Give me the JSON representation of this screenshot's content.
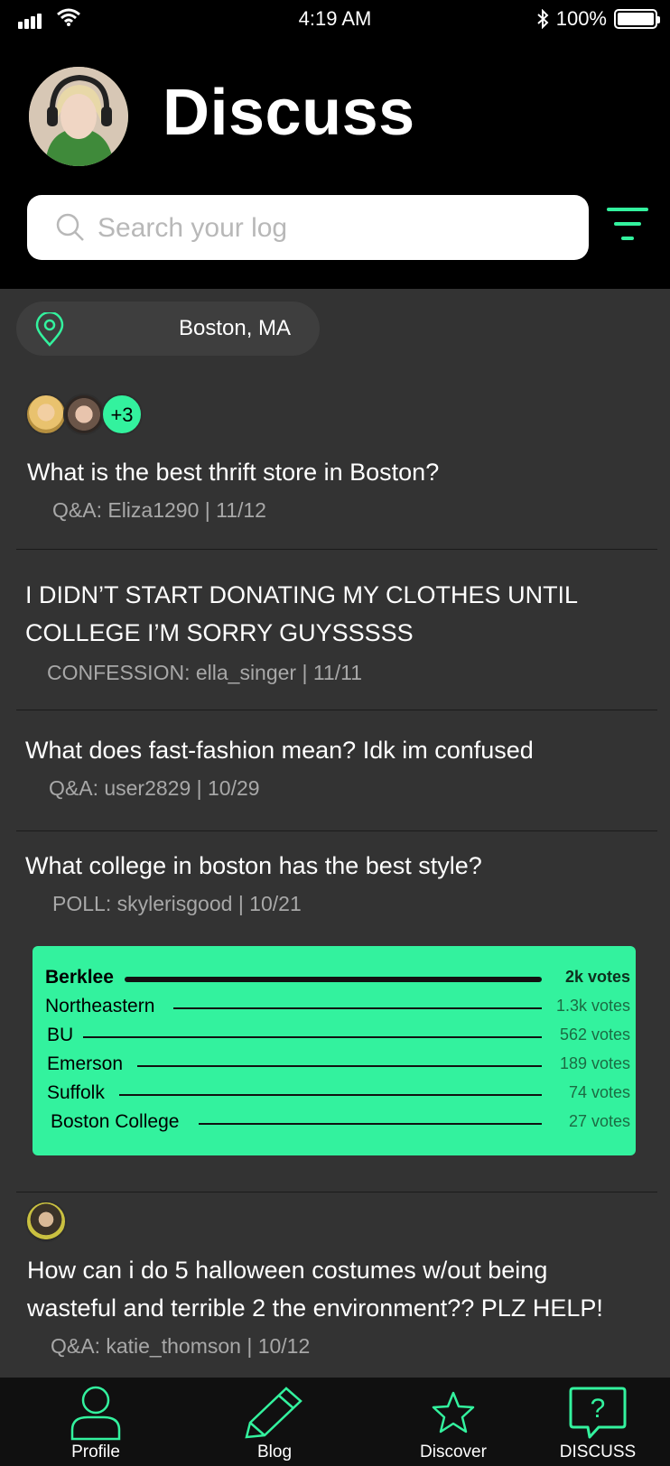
{
  "status_bar": {
    "time": "4:19 AM",
    "battery": "100%"
  },
  "header": {
    "title": "Discuss"
  },
  "search": {
    "placeholder": "Search your log"
  },
  "location": {
    "label": "Boston, MA"
  },
  "posts": [
    {
      "title": "What is the best thrift store in Boston?",
      "meta": "Q&A: Eliza1290  |  11/12",
      "extra_participants": "+3"
    },
    {
      "title_lines": [
        "I DIDN’T START DONATING MY CLOTHES UNTIL",
        "COLLEGE I’M SORRY GUYSSSSS"
      ],
      "meta": "CONFESSION: ella_singer  |  11/11"
    },
    {
      "title": "What does fast-fashion mean? Idk im confused",
      "meta": "Q&A: user2829  |  10/29"
    },
    {
      "title": "What college in boston has the best style?",
      "meta": "POLL: skylerisgood  |  10/21"
    },
    {
      "title_lines": [
        "How can i do 5 halloween costumes w/out being",
        "wasteful and terrible 2 the environment?? PLZ HELP!"
      ],
      "meta": "Q&A: katie_thomson  |  10/12"
    }
  ],
  "poll": {
    "options": [
      {
        "label": "Berklee",
        "votes": "2k votes"
      },
      {
        "label": "Northeastern",
        "votes": "1.3k votes"
      },
      {
        "label": "BU",
        "votes": "562 votes"
      },
      {
        "label": "Emerson",
        "votes": "189 votes"
      },
      {
        "label": "Suffolk",
        "votes": "74 votes"
      },
      {
        "label": "Boston College",
        "votes": "27 votes"
      }
    ]
  },
  "tabs": [
    {
      "label": "Profile",
      "icon": "person-icon"
    },
    {
      "label": "Blog",
      "icon": "pencil-icon"
    },
    {
      "label": "Discover",
      "icon": "star-icon"
    },
    {
      "label": "DISCUSS",
      "icon": "question-bubble-icon"
    }
  ],
  "colors": {
    "accent": "#33f29e",
    "background": "#333333",
    "header": "#000000"
  }
}
